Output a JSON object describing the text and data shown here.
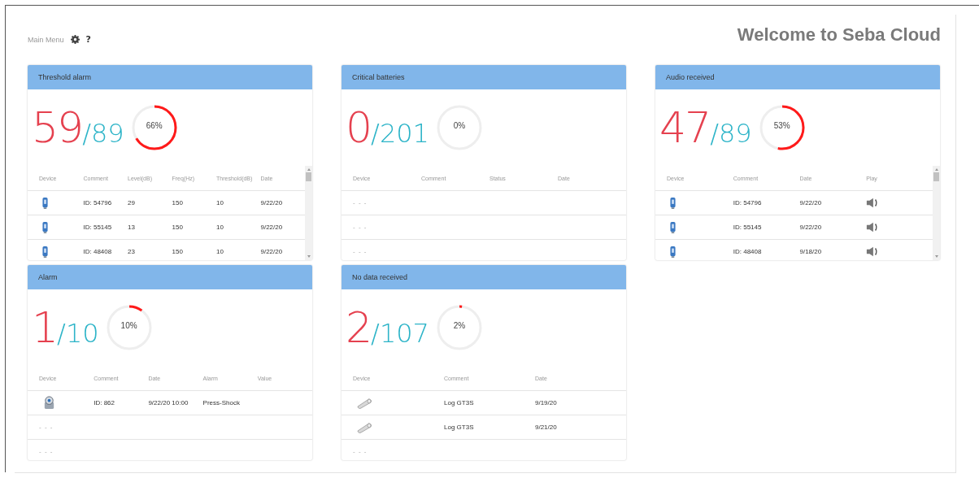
{
  "header": {
    "menu_link": "Main Menu",
    "help": "?",
    "title": "Welcome to Seba Cloud"
  },
  "cards": [
    {
      "title": "Threshold alarm",
      "count": "59",
      "total": "/89",
      "percent": "66%",
      "scrollable": true,
      "columns": [
        "Device",
        "Comment",
        "Level(dB)",
        "Freq(Hz)",
        "Threshold(dB)",
        "Date"
      ],
      "rows": [
        {
          "kind": "sensor",
          "cells": [
            "",
            "ID: 54796",
            "29",
            "150",
            "10",
            "9/22/20"
          ]
        },
        {
          "kind": "sensor",
          "cells": [
            "",
            "ID: 55145",
            "13",
            "150",
            "10",
            "9/22/20"
          ]
        },
        {
          "kind": "sensor",
          "cells": [
            "",
            "ID: 48408",
            "23",
            "150",
            "10",
            "9/22/20"
          ]
        }
      ]
    },
    {
      "title": "Critical batteries",
      "count": "0",
      "total": "/201",
      "percent": "0%",
      "scrollable": false,
      "columns": [
        "Device",
        "Comment",
        "Status",
        "Date"
      ],
      "rows": [
        {
          "kind": "empty",
          "text": "- - -"
        },
        {
          "kind": "empty",
          "text": "- - -"
        },
        {
          "kind": "empty",
          "text": "- - -"
        }
      ]
    },
    {
      "title": "Audio received",
      "count": "47",
      "total": "/89",
      "percent": "53%",
      "scrollable": true,
      "columns": [
        "Device",
        "Comment",
        "Date",
        "Play"
      ],
      "rows": [
        {
          "kind": "sensor",
          "cells": [
            "",
            "ID: 54796",
            "9/22/20"
          ],
          "play": true
        },
        {
          "kind": "sensor",
          "cells": [
            "",
            "ID: 55145",
            "9/22/20"
          ],
          "play": true
        },
        {
          "kind": "sensor",
          "cells": [
            "",
            "ID: 48408",
            "9/18/20"
          ],
          "play": true
        }
      ]
    },
    {
      "title": "Alarm",
      "count": "1",
      "total": "/10",
      "percent": "10%",
      "scrollable": false,
      "columns": [
        "Device",
        "Comment",
        "Date",
        "Alarm",
        "Value"
      ],
      "rows": [
        {
          "kind": "gauge",
          "cells": [
            "",
            "ID: 862",
            "9/22/20 10:00",
            "Press-Shock"
          ]
        },
        {
          "kind": "empty",
          "text": "- - -"
        },
        {
          "kind": "empty",
          "text": "- - -"
        }
      ]
    },
    {
      "title": "No data received",
      "count": "2",
      "total": "/107",
      "percent": "2%",
      "scrollable": false,
      "columns": [
        "Device",
        "Comment",
        "Date"
      ],
      "rows": [
        {
          "kind": "logger",
          "cells": [
            "",
            "Log GT3S",
            "9/19/20"
          ]
        },
        {
          "kind": "logger",
          "cells": [
            "",
            "Log GT3S",
            "9/21/20"
          ]
        },
        {
          "kind": "empty",
          "text": "- - -"
        }
      ]
    }
  ]
}
